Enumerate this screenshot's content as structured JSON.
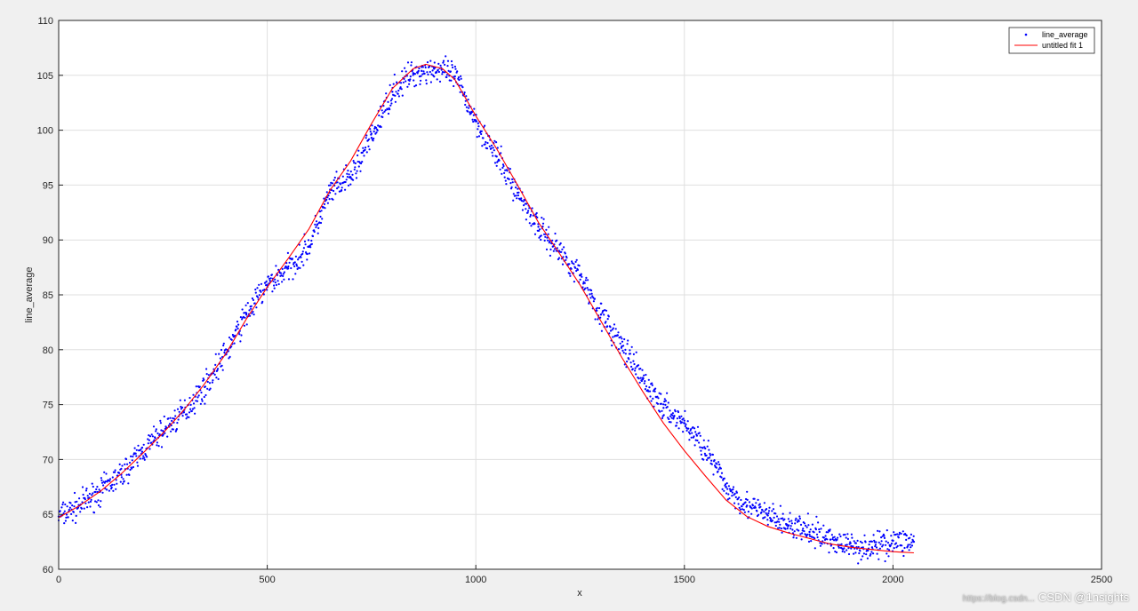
{
  "chart_data": {
    "type": "scatter",
    "title": "",
    "xlabel": "x",
    "ylabel": "line_average",
    "xlim": [
      0,
      2500
    ],
    "ylim": [
      60,
      110
    ],
    "x_ticks": [
      0,
      500,
      1000,
      1500,
      2000,
      2500
    ],
    "y_ticks": [
      60,
      65,
      70,
      75,
      80,
      85,
      90,
      95,
      100,
      105,
      110
    ],
    "grid": true,
    "legend_position": "top-right",
    "series": [
      {
        "name": "line_average",
        "kind": "scatter",
        "color": "#0000ff",
        "x": [
          0,
          50,
          100,
          150,
          200,
          250,
          300,
          350,
          400,
          450,
          500,
          550,
          600,
          650,
          700,
          750,
          800,
          850,
          870,
          900,
          950,
          1000,
          1050,
          1100,
          1150,
          1200,
          1250,
          1300,
          1350,
          1400,
          1450,
          1500,
          1550,
          1600,
          1650,
          1700,
          1750,
          1800,
          1850,
          1900,
          1950,
          2000,
          2050
        ],
        "y": [
          64.8,
          65.8,
          67.1,
          68.6,
          70.7,
          72.6,
          74.3,
          76.6,
          79.6,
          83.2,
          85.9,
          87.4,
          89.4,
          94.3,
          95.7,
          99.3,
          103.5,
          105.2,
          105.4,
          105.6,
          104.9,
          100.9,
          97.6,
          94.3,
          91.2,
          89.0,
          86.8,
          83.2,
          80.3,
          77.3,
          74.7,
          73.3,
          71.0,
          67.5,
          65.8,
          64.9,
          64.0,
          63.4,
          62.7,
          62.1,
          62.0,
          62.6,
          62.5
        ]
      },
      {
        "name": "untitled fit 1",
        "kind": "line",
        "color": "#ff0000",
        "x": [
          0,
          50,
          100,
          150,
          200,
          250,
          300,
          350,
          400,
          450,
          500,
          550,
          600,
          650,
          700,
          750,
          800,
          850,
          880,
          920,
          950,
          1000,
          1050,
          1100,
          1150,
          1200,
          1250,
          1300,
          1350,
          1400,
          1450,
          1500,
          1550,
          1600,
          1650,
          1700,
          1750,
          1800,
          1850,
          1900,
          1950,
          2000,
          2050
        ],
        "y": [
          64.7,
          65.8,
          67.1,
          68.7,
          70.5,
          72.4,
          74.5,
          76.9,
          79.6,
          82.8,
          85.7,
          88.3,
          91.0,
          94.5,
          97.2,
          100.6,
          103.8,
          105.6,
          106.0,
          105.6,
          104.6,
          101.3,
          98.3,
          95.0,
          91.6,
          88.8,
          85.9,
          82.6,
          79.3,
          76.2,
          73.3,
          70.8,
          68.5,
          66.3,
          64.8,
          63.9,
          63.3,
          62.8,
          62.3,
          62.0,
          61.8,
          61.6,
          61.5
        ]
      }
    ]
  },
  "watermark": {
    "faint": "https://blog.csdn...",
    "text": "CSDN @1nsights"
  }
}
